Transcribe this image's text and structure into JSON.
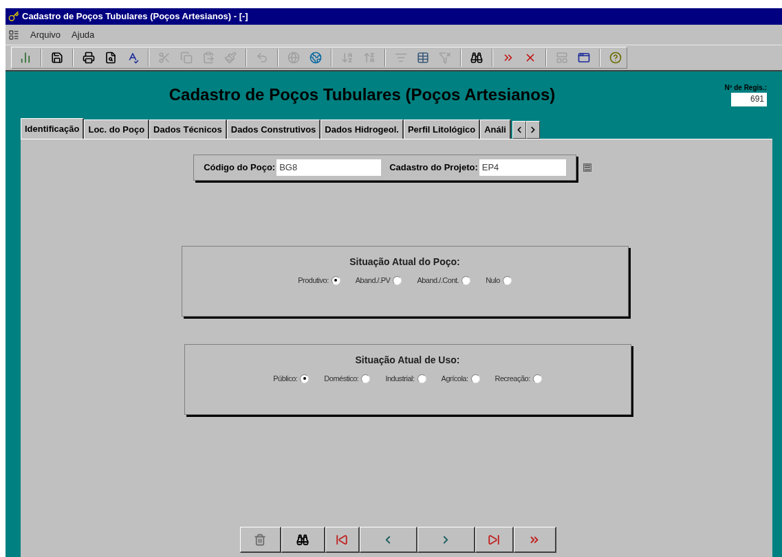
{
  "window": {
    "title": "Cadastro de Poços Tubulares (Poços Artesianos) - [-]"
  },
  "menu": [
    "Arquivo",
    "Ajuda"
  ],
  "toolbar": [
    {
      "disabled": false
    },
    {
      "disabled": false
    },
    {
      "disabled": false
    },
    {
      "disabled": false
    },
    {
      "disabled": false
    },
    {
      "disabled": true
    },
    {
      "disabled": true
    },
    {
      "disabled": true
    },
    {
      "disabled": true
    },
    {
      "disabled": true
    },
    {
      "disabled": true
    },
    {
      "disabled": false
    },
    {
      "disabled": true
    },
    {
      "disabled": true
    },
    {
      "disabled": true
    },
    {
      "disabled": false
    },
    {
      "disabled": true
    },
    {
      "disabled": false
    },
    {
      "disabled": false
    },
    {
      "disabled": false
    },
    {
      "disabled": true
    },
    {
      "disabled": false
    },
    {
      "disabled": false
    }
  ],
  "form": {
    "title": "Cadastro de Poços Tubulares (Poços Artesianos)",
    "record_label": "Nº de Regis.:",
    "record_number": "691"
  },
  "tabs": [
    {
      "label": "Identificação",
      "selected": true
    },
    {
      "label": "Loc. do Poço",
      "selected": false
    },
    {
      "label": "Dados Técnicos",
      "selected": false
    },
    {
      "label": "Dados Construtivos",
      "selected": false
    },
    {
      "label": "Dados Hidrogeol.",
      "selected": false
    },
    {
      "label": "Perfil Litológico",
      "selected": false
    },
    {
      "label": "Análi",
      "selected": false
    }
  ],
  "fields": [
    {
      "label": "Código do Poço:",
      "value": "BG8"
    },
    {
      "label": "Cadastro do Projeto:",
      "value": "EP4"
    }
  ],
  "groups": [
    {
      "title": "Situação Atual do Poço:",
      "options": [
        {
          "label": "Produtivo:",
          "selected": true
        },
        {
          "label": "Aband./.PV",
          "selected": false
        },
        {
          "label": "Aband./.Cont.",
          "selected": false
        },
        {
          "label": "Nulo",
          "selected": false
        }
      ]
    },
    {
      "title": "Situação Atual de Uso:",
      "options": [
        {
          "label": "Público:",
          "selected": true
        },
        {
          "label": "Doméstico:",
          "selected": false
        },
        {
          "label": "Industrial:",
          "selected": false
        },
        {
          "label": "Agrícola:",
          "selected": false
        },
        {
          "label": "Recreação:",
          "selected": false
        }
      ]
    }
  ]
}
